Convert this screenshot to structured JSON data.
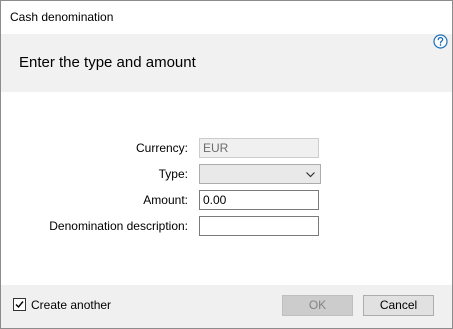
{
  "window": {
    "title": "Cash denomination"
  },
  "header": {
    "heading": "Enter the type and amount",
    "help_icon": "question-mark-circle-icon"
  },
  "form": {
    "currency": {
      "label": "Currency:",
      "value": "EUR",
      "enabled": false
    },
    "type": {
      "label": "Type:",
      "value": "",
      "control": "dropdown"
    },
    "amount": {
      "label": "Amount:",
      "value": "0.00"
    },
    "description": {
      "label": "Denomination description:",
      "value": ""
    }
  },
  "footer": {
    "create_another": {
      "label": "Create another",
      "checked": true
    },
    "ok_label": "OK",
    "ok_enabled": false,
    "cancel_label": "Cancel"
  },
  "colors": {
    "header_bg": "#f1f1f1",
    "footer_bg": "#f0f0f0",
    "help_icon": "#1e6fb8"
  }
}
